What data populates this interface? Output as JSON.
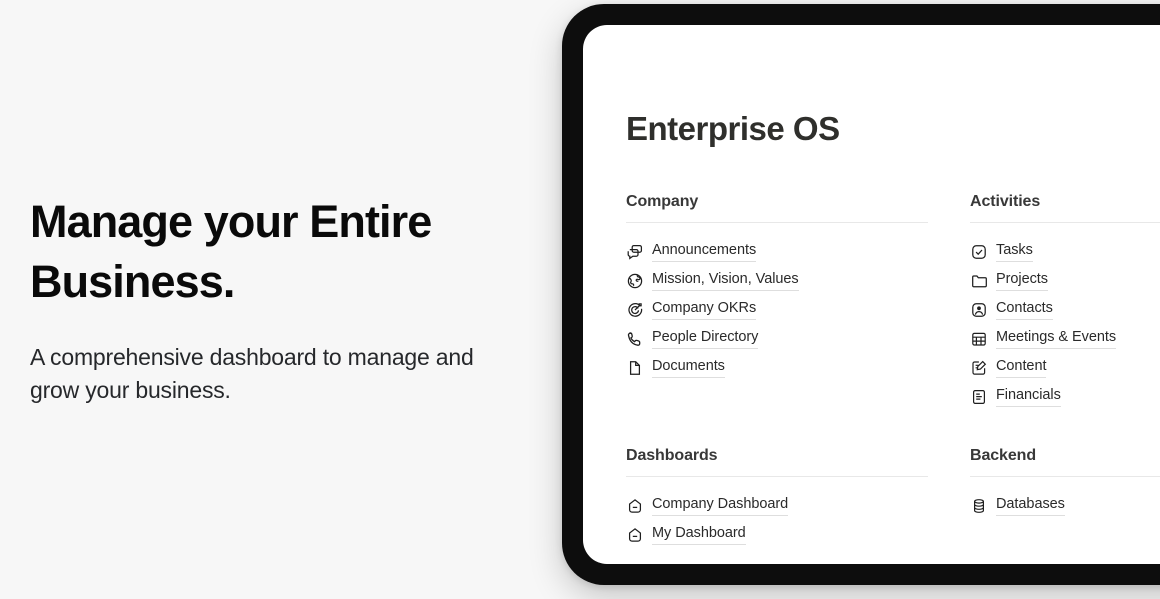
{
  "hero": {
    "headline": "Manage your Entire Business.",
    "subhead": "A comprehensive dashboard to manage and grow your business."
  },
  "device": {
    "app_title": "Enterprise OS",
    "sections": [
      {
        "title": "Company",
        "items": [
          {
            "label": "Announcements",
            "icon": "announcement-icon"
          },
          {
            "label": "Mission, Vision, Values",
            "icon": "globe-icon"
          },
          {
            "label": "Company OKRs",
            "icon": "target-icon"
          },
          {
            "label": "People Directory",
            "icon": "phone-icon"
          },
          {
            "label": "Documents",
            "icon": "document-icon"
          }
        ]
      },
      {
        "title": "Activities",
        "items": [
          {
            "label": "Tasks",
            "icon": "check-circle-icon"
          },
          {
            "label": "Projects",
            "icon": "folder-icon"
          },
          {
            "label": "Contacts",
            "icon": "contact-card-icon"
          },
          {
            "label": "Meetings & Events",
            "icon": "calendar-icon"
          },
          {
            "label": "Content",
            "icon": "edit-document-icon"
          },
          {
            "label": "Financials",
            "icon": "report-icon"
          }
        ]
      },
      {
        "title": "Dashboards",
        "items": [
          {
            "label": "Company Dashboard",
            "icon": "gauge-icon"
          },
          {
            "label": "My Dashboard",
            "icon": "gauge-icon"
          }
        ]
      },
      {
        "title": "Backend",
        "items": [
          {
            "label": "Databases",
            "icon": "database-icon"
          }
        ]
      }
    ]
  },
  "colors": {
    "page_background": "#f7f7f7",
    "device_bezel": "#0d0d0d",
    "screen_background": "#ffffff",
    "headline_text": "#0a0a0a",
    "body_text": "#26282b",
    "rule": "#e8e8e8"
  }
}
